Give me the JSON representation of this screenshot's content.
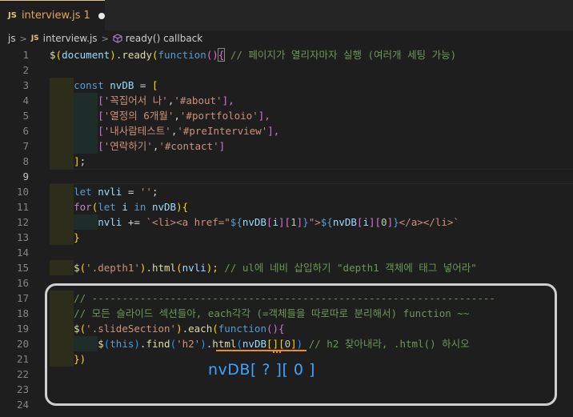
{
  "tab": {
    "icon": "JS",
    "name": "interview.js",
    "count": "1",
    "modified": true
  },
  "breadcrumb": {
    "folder": "js",
    "file_icon": "JS",
    "file": "interview.js",
    "symbol": "ready() callback"
  },
  "line_numbers": [
    "1",
    "2",
    "3",
    "4",
    "5",
    "6",
    "7",
    "8",
    "9",
    "10",
    "11",
    "12",
    "13",
    "14",
    "15",
    "16",
    "17",
    "18",
    "19",
    "20",
    "21",
    "22",
    "23",
    "24"
  ],
  "active_line": "9",
  "code": {
    "l1": [
      "$",
      "(",
      "document",
      ")",
      ".",
      "ready",
      "(",
      "function",
      "()",
      "{",
      " // 페이지가 열리자마자 실행 (여러개 세팅 가능)"
    ],
    "l3": [
      "const",
      " nvDB",
      " = ",
      "["
    ],
    "l4": [
      "[",
      "'꼭집어서 나'",
      ",",
      "'#about'",
      "],"
    ],
    "l5": [
      "[",
      "'열정의 6개월'",
      ",",
      "'#portfoloio'",
      "],"
    ],
    "l6": [
      "[",
      "'내사람테스트'",
      ",",
      "'#preInterview'",
      "],"
    ],
    "l7": [
      "[",
      "'연락하기'",
      ",",
      "'#contact'",
      "]"
    ],
    "l8": [
      "]",
      ";"
    ],
    "l10": [
      "let",
      " nvli",
      " = ",
      "''",
      ";"
    ],
    "l11": [
      "for",
      "(",
      "let",
      " i ",
      "in",
      " nvDB",
      "){"
    ],
    "l12": [
      "nvli",
      " += ",
      "`<li><a href=\"",
      "${",
      "nvDB",
      "[",
      "i",
      "][",
      "1",
      "]",
      "}",
      "\">",
      "${",
      "nvDB",
      "[",
      "i",
      "][",
      "0",
      "]",
      "}",
      "</a></li>`"
    ],
    "l13": [
      "}"
    ],
    "l15": [
      "$",
      "(",
      "'.depth1'",
      ")",
      ".",
      "html",
      "(",
      "nvli",
      ");",
      " // ul에 네비 삽입하기 \"depth1 객체에 태그 넣어라\""
    ],
    "l17": [
      "// -------------------------------------------------------------------"
    ],
    "l18": [
      "// 모든 슬라이드 섹션들아, each각각 (=객체들을 따로따로 분리해서) function ~~"
    ],
    "l19": [
      "$",
      "(",
      "'.slideSection'",
      ")",
      ".",
      "each",
      "(",
      "function",
      "(){"
    ],
    "l20": [
      "$",
      "(",
      "this",
      ")",
      ".",
      "find",
      "(",
      "'h2'",
      ")",
      ".",
      "html",
      "(",
      "nvDB",
      "[",
      "]",
      "[",
      "0",
      "]",
      ")",
      " // h2 찾아내라, .html() 하시오"
    ],
    "l21": [
      "})"
    ]
  },
  "annotation": "nvDB[ ? ][ 0 ]",
  "colors": {
    "background": "#1e1e1e",
    "keyword": "#569cd6",
    "function": "#dcdcaa",
    "variable": "#9cdcfe",
    "string": "#ce9178",
    "comment": "#6a9955",
    "annotation": "#3fa3ff",
    "underline": "#f08a24",
    "highlight_box": "#cfcfcf"
  }
}
